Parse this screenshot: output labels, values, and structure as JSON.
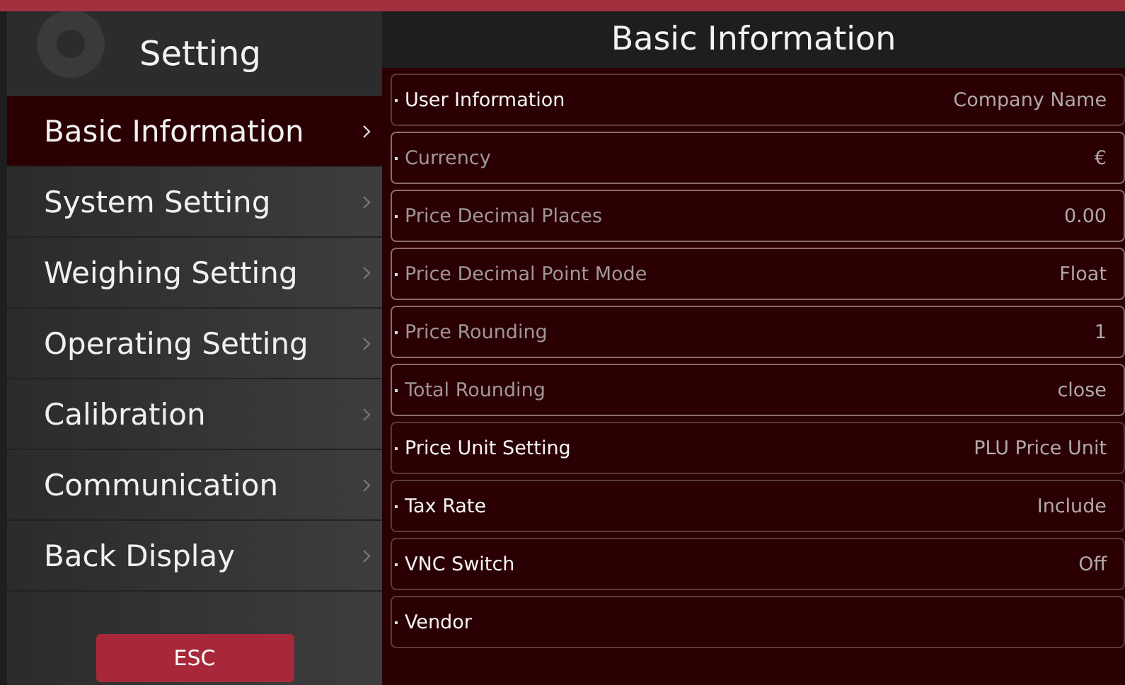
{
  "sidebar": {
    "title": "Setting",
    "items": [
      {
        "label": "Basic Information",
        "selected": true
      },
      {
        "label": "System Setting",
        "selected": false
      },
      {
        "label": "Weighing Setting",
        "selected": false
      },
      {
        "label": "Operating Setting",
        "selected": false
      },
      {
        "label": "Calibration",
        "selected": false
      },
      {
        "label": "Communication",
        "selected": false
      },
      {
        "label": "Back Display",
        "selected": false
      }
    ],
    "esc_button": "ESC"
  },
  "panel": {
    "title": "Basic Information",
    "rows": [
      {
        "label": "User Information",
        "value": "Company Name",
        "disabled": false
      },
      {
        "label": "Currency",
        "value": "€",
        "disabled": true
      },
      {
        "label": "Price Decimal Places",
        "value": "0.00",
        "disabled": true
      },
      {
        "label": "Price Decimal Point Mode",
        "value": "Float",
        "disabled": true
      },
      {
        "label": "Price Rounding",
        "value": "1",
        "disabled": true
      },
      {
        "label": "Total Rounding",
        "value": "close",
        "disabled": true
      },
      {
        "label": "Price Unit Setting",
        "value": "PLU Price Unit",
        "disabled": false
      },
      {
        "label": "Tax Rate",
        "value": "Include",
        "disabled": false
      },
      {
        "label": "VNC Switch",
        "value": "Off",
        "disabled": false
      },
      {
        "label": "Vendor",
        "disabled": false
      }
    ]
  }
}
